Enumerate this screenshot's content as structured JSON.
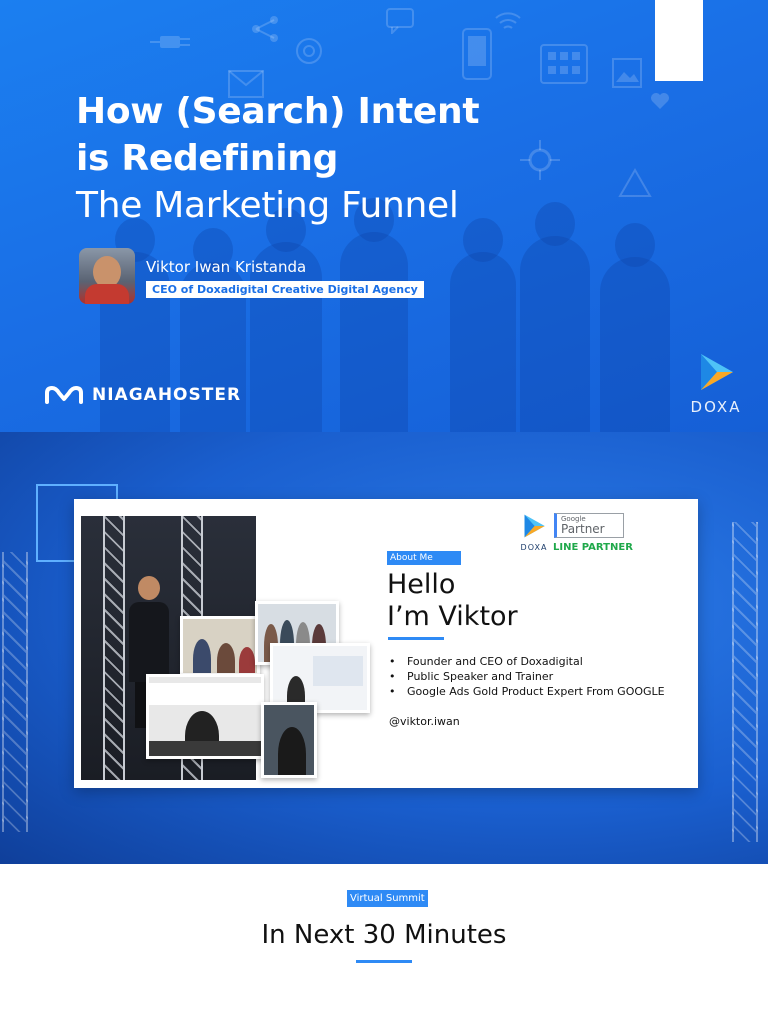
{
  "slide1": {
    "title_line1": "How (Search) Intent",
    "title_line2": "is Redefining",
    "title_line3": "The Marketing Funnel",
    "speaker_name": "Viktor Iwan Kristanda",
    "speaker_role": "CEO of Doxadigital Creative Digital Agency",
    "brand_left": "NIAGAHOSTER",
    "brand_right": "DOXA"
  },
  "slide2": {
    "badge": "About Me",
    "greeting_line1": "Hello",
    "greeting_line2": "I’m Viktor",
    "bullets": [
      "Founder and CEO of Doxadigital",
      "Public Speaker and Trainer",
      "Google Ads Gold Product Expert  From GOOGLE"
    ],
    "handle": "@viktor.iwan",
    "doxa_label": "DOXA",
    "google_partner_small": "Google",
    "google_partner_big": "Partner",
    "line_partner": "LINE PARTNER"
  },
  "slide3": {
    "badge": "Virtual Summit",
    "heading": "In Next 30 Minutes"
  },
  "colors": {
    "primary_blue": "#1a6fe6",
    "accent_blue": "#2e8af5",
    "line_green": "#1fa84a"
  }
}
